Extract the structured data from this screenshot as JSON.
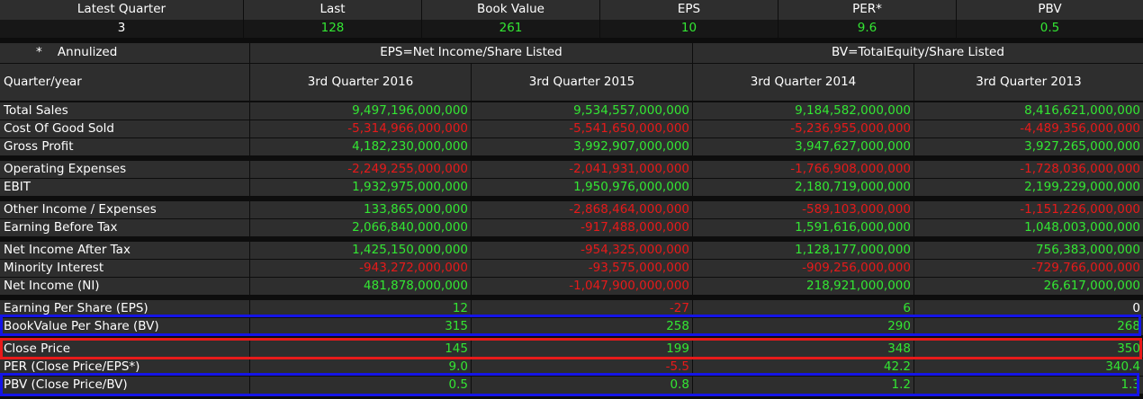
{
  "summary": {
    "headers": [
      "Latest Quarter",
      "Last",
      "Book Value",
      "EPS",
      "PER*",
      "PBV"
    ],
    "values": [
      "3",
      "128",
      "261",
      "10",
      "9.6",
      "0.5"
    ]
  },
  "table": {
    "annualized_label": "*    Annulized",
    "eps_formula": "EPS=Net Income/Share Listed",
    "bv_formula": "BV=TotalEquity/Share Listed",
    "period_label": "Quarter/year",
    "periods": [
      "3rd Quarter 2016",
      "3rd Quarter 2015",
      "3rd Quarter 2014",
      "3rd Quarter 2013"
    ],
    "rows": [
      {
        "label": "Total Sales",
        "values": [
          "9,497,196,000,000",
          "9,534,557,000,000",
          "9,184,582,000,000",
          "8,416,621,000,000"
        ],
        "signs": [
          "pos",
          "pos",
          "pos",
          "pos"
        ]
      },
      {
        "label": "Cost Of Good Sold",
        "values": [
          "-5,314,966,000,000",
          "-5,541,650,000,000",
          "-5,236,955,000,000",
          "-4,489,356,000,000"
        ],
        "signs": [
          "neg",
          "neg",
          "neg",
          "neg"
        ]
      },
      {
        "label": "Gross Profit",
        "values": [
          "4,182,230,000,000",
          "3,992,907,000,000",
          "3,947,627,000,000",
          "3,927,265,000,000"
        ],
        "signs": [
          "pos",
          "pos",
          "pos",
          "pos"
        ]
      },
      {
        "label": "Operating Expenses",
        "values": [
          "-2,249,255,000,000",
          "-2,041,931,000,000",
          "-1,766,908,000,000",
          "-1,728,036,000,000"
        ],
        "signs": [
          "neg",
          "neg",
          "neg",
          "neg"
        ]
      },
      {
        "label": "EBIT",
        "values": [
          "1,932,975,000,000",
          "1,950,976,000,000",
          "2,180,719,000,000",
          "2,199,229,000,000"
        ],
        "signs": [
          "pos",
          "pos",
          "pos",
          "pos"
        ]
      },
      {
        "label": "Other Income / Expenses",
        "values": [
          "133,865,000,000",
          "-2,868,464,000,000",
          "-589,103,000,000",
          "-1,151,226,000,000"
        ],
        "signs": [
          "pos",
          "neg",
          "neg",
          "neg"
        ]
      },
      {
        "label": "Earning Before Tax",
        "values": [
          "2,066,840,000,000",
          "-917,488,000,000",
          "1,591,616,000,000",
          "1,048,003,000,000"
        ],
        "signs": [
          "pos",
          "neg",
          "pos",
          "pos"
        ]
      },
      {
        "label": "Net Income After Tax",
        "values": [
          "1,425,150,000,000",
          "-954,325,000,000",
          "1,128,177,000,000",
          "756,383,000,000"
        ],
        "signs": [
          "pos",
          "neg",
          "pos",
          "pos"
        ]
      },
      {
        "label": "Minority Interest",
        "values": [
          "-943,272,000,000",
          "-93,575,000,000",
          "-909,256,000,000",
          "-729,766,000,000"
        ],
        "signs": [
          "neg",
          "neg",
          "neg",
          "neg"
        ]
      },
      {
        "label": "Net Income (NI)",
        "values": [
          "481,878,000,000",
          "-1,047,900,000,000",
          "218,921,000,000",
          "26,617,000,000"
        ],
        "signs": [
          "pos",
          "neg",
          "pos",
          "pos"
        ]
      },
      {
        "label": "Earning Per Share (EPS)",
        "values": [
          "12",
          "-27",
          "6",
          "0"
        ],
        "signs": [
          "pos",
          "neg",
          "pos",
          "wht"
        ]
      },
      {
        "label": "BookValue Per Share (BV)",
        "values": [
          "315",
          "258",
          "290",
          "268"
        ],
        "signs": [
          "pos",
          "pos",
          "pos",
          "pos"
        ]
      },
      {
        "label": "Close Price",
        "values": [
          "145",
          "199",
          "348",
          "350"
        ],
        "signs": [
          "pos",
          "pos",
          "pos",
          "pos"
        ]
      },
      {
        "label": "PER (Close Price/EPS*)",
        "values": [
          "9.0",
          "-5.5",
          "42.2",
          "340.4"
        ],
        "signs": [
          "pos",
          "neg",
          "pos",
          "pos"
        ]
      },
      {
        "label": "PBV (Close Price/BV)",
        "values": [
          "0.5",
          "0.8",
          "1.2",
          "1.3"
        ],
        "signs": [
          "pos",
          "pos",
          "pos",
          "pos"
        ]
      }
    ]
  },
  "colors": {
    "positive": "#33e633",
    "negative": "#e61a1a",
    "highlight_blue": "#1515e6",
    "highlight_red": "#e81a1a"
  }
}
